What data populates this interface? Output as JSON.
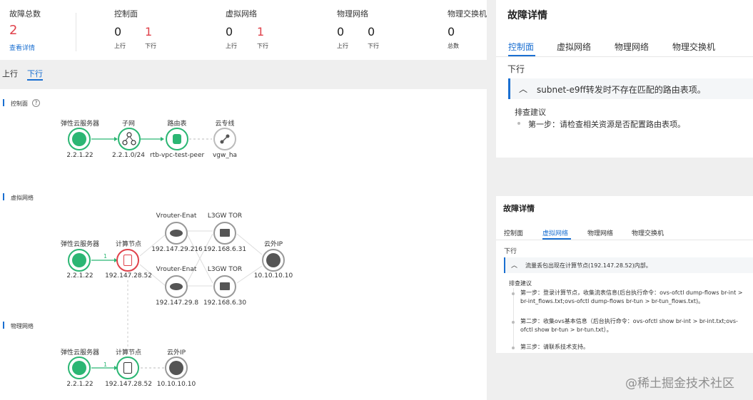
{
  "summary": {
    "total_label": "故障总数",
    "total_value": "2",
    "view_detail": "查看详情",
    "groups": [
      {
        "title": "控制面",
        "up_label": "上行",
        "down_label": "下行",
        "up_value": "0",
        "down_value": "1"
      },
      {
        "title": "虚拟网络",
        "up_label": "上行",
        "down_label": "下行",
        "up_value": "0",
        "down_value": "1"
      },
      {
        "title": "物理网络",
        "up_label": "上行",
        "down_label": "下行",
        "up_value": "0",
        "down_value": "0"
      },
      {
        "title": "物理交换机",
        "total_label": "总数",
        "value": "0"
      }
    ]
  },
  "direction_tabs": {
    "up": "上行",
    "down": "下行"
  },
  "topology": {
    "control": {
      "title": "控制面",
      "help_icon": "question-circle-icon",
      "nodes": [
        {
          "name": "弹性云服务器",
          "sub": "2.2.1.22",
          "icon": "cloud-icon"
        },
        {
          "name": "子网",
          "sub": "2.2.1.0/24",
          "icon": "subnet-icon"
        },
        {
          "name": "路由表",
          "sub": "rtb-vpc-test-peer",
          "icon": "route-table-icon"
        },
        {
          "name": "云专线",
          "sub": "vgw_ha",
          "icon": "direct-connect-icon"
        }
      ]
    },
    "virtual": {
      "title": "虚拟网络",
      "ecs": {
        "name": "弹性云服务器",
        "sub": "2.2.1.22"
      },
      "compute": {
        "name": "计算节点",
        "sub": "192.147.28.52"
      },
      "vrouter1": {
        "name": "Vrouter-Enat",
        "sub": "192.147.29.216"
      },
      "vrouter2": {
        "name": "Vrouter-Enat",
        "sub": "192.147.29.8"
      },
      "tor1": {
        "name": "L3GW TOR",
        "sub": "192.168.6.31"
      },
      "tor2": {
        "name": "L3GW TOR",
        "sub": "192.168.6.30"
      },
      "ext": {
        "name": "云外IP",
        "sub": "10.10.10.10"
      },
      "link_count": "1"
    },
    "physical": {
      "title": "物理网络",
      "ecs": {
        "name": "弹性云服务器",
        "sub": "2.2.1.22"
      },
      "compute": {
        "name": "计算节点",
        "sub": "192.147.28.52"
      },
      "ext": {
        "name": "云外IP",
        "sub": "10.10.10.10"
      },
      "link_count": "1"
    }
  },
  "detail_top": {
    "title": "故障详情",
    "tabs": [
      "控制面",
      "虚拟网络",
      "物理网络",
      "物理交换机"
    ],
    "active_tab": 0,
    "direction": "下行",
    "issue": "subnet-e9ff转发时不存在匹配的路由表项。",
    "advice_title": "排查建议",
    "steps": [
      "第一步：请检查相关资源是否配置路由表项。"
    ]
  },
  "detail_bottom": {
    "title": "故障详情",
    "tabs": [
      "控制面",
      "虚拟网络",
      "物理网络",
      "物理交换机"
    ],
    "active_tab": 1,
    "direction": "下行",
    "issue": "流量丢包出现在计算节点(192.147.28.52)内部。",
    "advice_title": "排查建议",
    "steps": [
      "第一步：登录计算节点，收集流表信息(后台执行命令：ovs-ofctl dump-flows br-int > br-int_flows.txt;ovs-ofctl dump-flows br-tun > br-tun_flows.txt)。",
      "第二步：收集ovs基本信息（后台执行命令：ovs-ofctl show br-int > br-int.txt;ovs-ofctl show br-tun > br-tun.txt）。",
      "第三步：请联系技术支持。"
    ]
  },
  "watermark": "@稀土掘金技术社区",
  "colors": {
    "accent": "#1a6fd1",
    "error": "#e0424b",
    "ok": "#2bb673"
  }
}
